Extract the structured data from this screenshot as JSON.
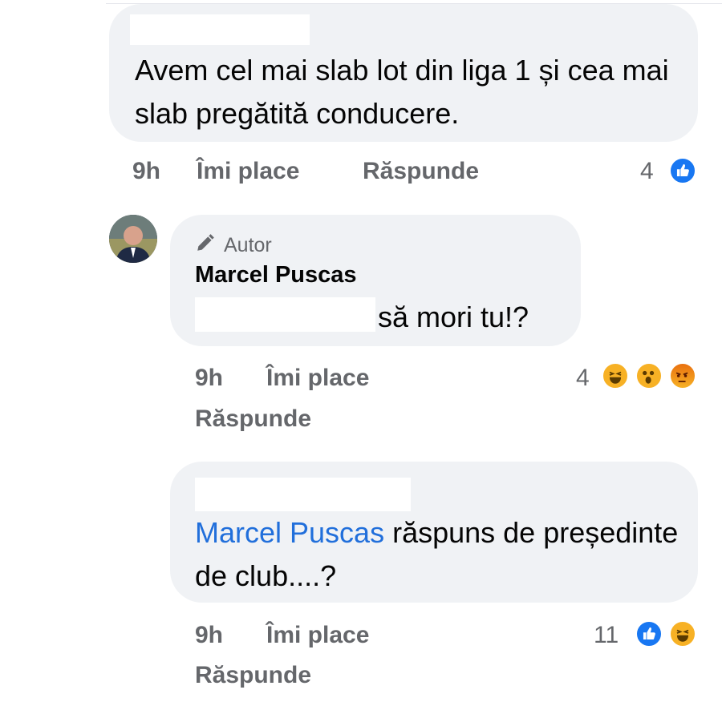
{
  "comments": [
    {
      "text": "Avem cel mai slab lot din liga 1 și cea mai slab pregătită conducere.",
      "time": "9h",
      "like_label": "Îmi place",
      "reply_label": "Răspunde",
      "reaction_count": "4",
      "reactions": [
        "like-icon"
      ]
    },
    {
      "author_badge": "Autor",
      "author_name": "Marcel Puscas",
      "text": "să mori tu!?",
      "time": "9h",
      "like_label": "Îmi place",
      "reply_label": "Răspunde",
      "reaction_count": "4",
      "reactions": [
        "haha-icon",
        "wow-icon",
        "angry-icon"
      ]
    },
    {
      "mention": "Marcel Puscas",
      "text": " răspuns de președinte de club....?",
      "time": "9h",
      "like_label": "Îmi place",
      "reply_label": "Răspunde",
      "reaction_count": "11",
      "reactions": [
        "like-icon",
        "haha-icon"
      ]
    }
  ],
  "colors": {
    "bubble": "#f0f2f5",
    "meta_text": "#65676b",
    "mention": "#216fdb",
    "like_blue": "#1877f2",
    "emoji_yellow": "#f7b125"
  }
}
